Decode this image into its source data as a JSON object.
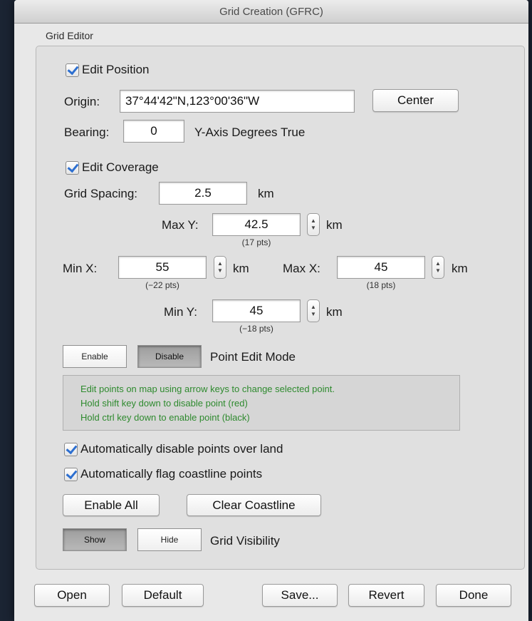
{
  "window": {
    "title": "Grid Creation (GFRC)"
  },
  "group": {
    "label": "Grid Editor"
  },
  "position": {
    "edit_label": "Edit Position",
    "origin_label": "Origin:",
    "origin_value": "37°44'42\"N,123°00'36\"W",
    "center_button": "Center",
    "bearing_label": "Bearing:",
    "bearing_value": "0",
    "bearing_units": "Y-Axis Degrees True"
  },
  "coverage": {
    "edit_label": "Edit Coverage",
    "spacing_label": "Grid Spacing:",
    "spacing_value": "2.5",
    "spacing_units": "km",
    "max_y": {
      "label": "Max Y:",
      "value": "42.5",
      "units": "km",
      "pts": "(17 pts)"
    },
    "min_x": {
      "label": "Min X:",
      "value": "55",
      "units": "km",
      "pts": "(−22 pts)"
    },
    "max_x": {
      "label": "Max X:",
      "value": "45",
      "units": "km",
      "pts": "(18 pts)"
    },
    "min_y": {
      "label": "Min Y:",
      "value": "45",
      "units": "km",
      "pts": "(−18 pts)"
    }
  },
  "point_edit": {
    "enable_label": "Enable",
    "disable_label": "Disable",
    "mode_label": "Point Edit Mode",
    "selected": "Disable"
  },
  "info": {
    "line1": "Edit points on map using arrow keys to change selected point.",
    "line2": "Hold shift key down to disable point (red)",
    "line3": "Hold ctrl key down to enable point (black)",
    "color": "#2e8a2e"
  },
  "options": {
    "disable_land": "Automatically disable points over land",
    "flag_coastline": "Automatically flag coastline points"
  },
  "actions": {
    "enable_all": "Enable All",
    "clear_coastline": "Clear Coastline"
  },
  "visibility": {
    "show_label": "Show",
    "hide_label": "Hide",
    "label": "Grid Visibility",
    "selected": "Show"
  },
  "footer": {
    "open": "Open",
    "default": "Default",
    "save": "Save...",
    "revert": "Revert",
    "done": "Done"
  }
}
